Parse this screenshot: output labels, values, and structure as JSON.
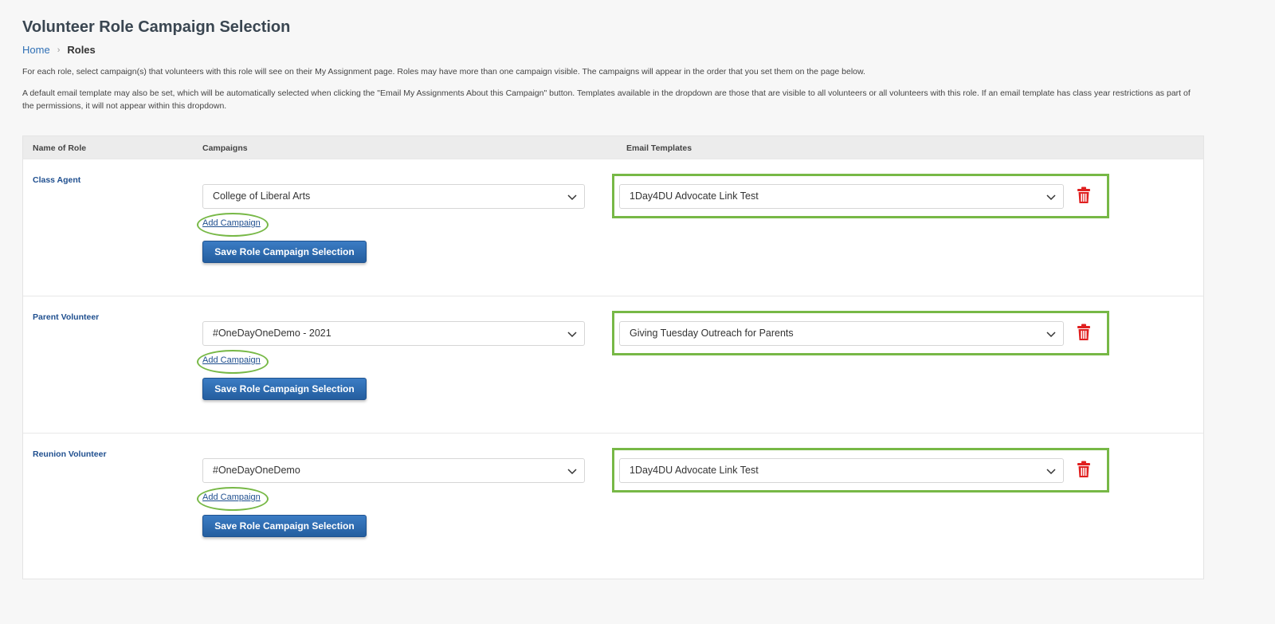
{
  "page": {
    "title": "Volunteer Role Campaign Selection",
    "breadcrumb": {
      "home": "Home",
      "separator": "›",
      "current": "Roles"
    },
    "description_1": "For each role, select campaign(s) that volunteers with this role will see on their My Assignment page. Roles may have more than one campaign visible. The campaigns will appear in the order that you set them on the page below.",
    "description_2": "A default email template may also be set, which will be automatically selected when clicking the \"Email My Assignments About this Campaign\" button. Templates available in the dropdown are those that are visible to all volunteers or all volunteers with this role. If an email template has class year restrictions as part of the permissions, it will not appear within this dropdown."
  },
  "table": {
    "headers": {
      "role": "Name of Role",
      "campaigns": "Campaigns",
      "templates": "Email Templates"
    },
    "rows": [
      {
        "role": "Class Agent",
        "campaign": "College of Liberal Arts",
        "add_campaign": "Add Campaign",
        "save": "Save Role Campaign Selection",
        "template": "1Day4DU Advocate Link Test"
      },
      {
        "role": "Parent Volunteer",
        "campaign": "#OneDayOneDemo - 2021",
        "add_campaign": "Add Campaign",
        "save": "Save Role Campaign Selection",
        "template": "Giving Tuesday Outreach for Parents"
      },
      {
        "role": "Reunion Volunteer",
        "campaign": "#OneDayOneDemo",
        "add_campaign": "Add Campaign",
        "save": "Save Role Campaign Selection",
        "template": "1Day4DU Advocate Link Test"
      }
    ]
  },
  "icons": {
    "dropdown": "chevron-down-icon",
    "delete": "trash-icon"
  },
  "colors": {
    "highlight": "#77b846",
    "link": "#1f4f8f",
    "button": "#2d6db0",
    "delete": "#e02020"
  }
}
